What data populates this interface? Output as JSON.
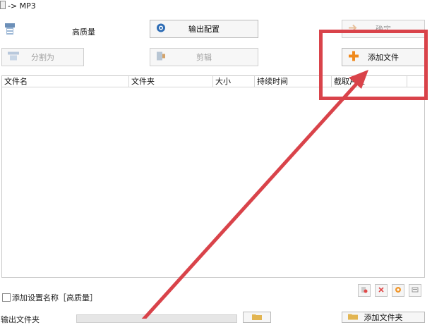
{
  "window": {
    "title": "-> MP3"
  },
  "top": {
    "quality_label": "高质量",
    "output_config_label": "输出配置",
    "ok_label": "确定",
    "split_label": "分割为",
    "clip_label": "剪辑",
    "add_file_label": "添加文件"
  },
  "table": {
    "columns": [
      "文件名",
      "文件夹",
      "大小",
      "持续时间",
      "截取片段"
    ]
  },
  "options": {
    "add_setting_name_label": "添加设置名称［高质量］",
    "add_setting_name_checked": false
  },
  "output": {
    "folder_label": "输出文件夹",
    "add_folder_label": "添加文件夹"
  },
  "colors": {
    "annotation": "#d9434a",
    "plus_icon": "#f08a1c"
  }
}
